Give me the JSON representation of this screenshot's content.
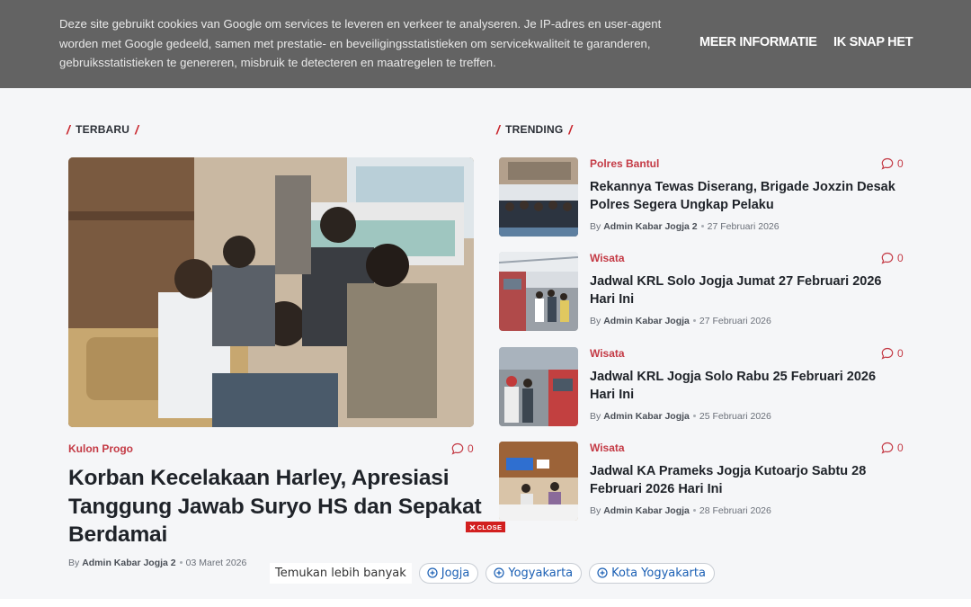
{
  "cookie": {
    "text": "Deze site gebruikt cookies van Google om services te leveren en verkeer te analyseren. Je IP-adres en user-agent worden met Google gedeeld, samen met prestatie- en beveiligingsstatistieken om servicekwaliteit te garanderen, gebruiksstatistieken te genereren, misbruik te detecteren en maatregelen te treffen.",
    "more_label": "Meer informatie",
    "ok_label": "Ik snap het"
  },
  "sections": {
    "latest": "TERBARU",
    "trending": "TRENDING"
  },
  "featured": {
    "category": "Kulon Progo",
    "comments": "0",
    "title": "Korban Kecelakaan Harley, Apresiasi Tanggung Jawab Suryo HS dan Sepakat Berdamai",
    "by": "By",
    "author": "Admin Kabar Jogja 2",
    "date": "03 Maret 2026"
  },
  "trending": [
    {
      "category": "Polres Bantul",
      "comments": "0",
      "title": "Rekannya Tewas Diserang, Brigade Joxzin Desak Polres Segera Ungkap Pelaku",
      "by": "By",
      "author": "Admin Kabar Jogja 2",
      "date": "27 Februari 2026"
    },
    {
      "category": "Wisata",
      "comments": "0",
      "title": "Jadwal KRL Solo Jogja Jumat 27 Februari 2026 Hari Ini",
      "by": "By",
      "author": "Admin Kabar Jogja",
      "date": "27 Februari 2026"
    },
    {
      "category": "Wisata",
      "comments": "0",
      "title": "Jadwal KRL Jogja Solo Rabu 25 Februari 2026 Hari Ini",
      "by": "By",
      "author": "Admin Kabar Jogja",
      "date": "25 Februari 2026"
    },
    {
      "category": "Wisata",
      "comments": "0",
      "title": "Jadwal KA Prameks Jogja Kutoarjo Sabtu 28 Februari 2026 Hari Ini",
      "by": "By",
      "author": "Admin Kabar Jogja",
      "date": "28 Februari 2026"
    }
  ],
  "ad": {
    "close_label": "CLOSE",
    "find_label": "Temukan lebih banyak",
    "chips": [
      "Jogja",
      "Yogyakarta",
      "Kota Yogyakarta"
    ]
  },
  "icons": {
    "comment": "comment-bubble-icon",
    "close": "close-x-icon",
    "chip": "plus-circle-icon"
  },
  "colors": {
    "accent": "#c43a45",
    "banner": "#636363",
    "link": "#1a5fb4"
  }
}
